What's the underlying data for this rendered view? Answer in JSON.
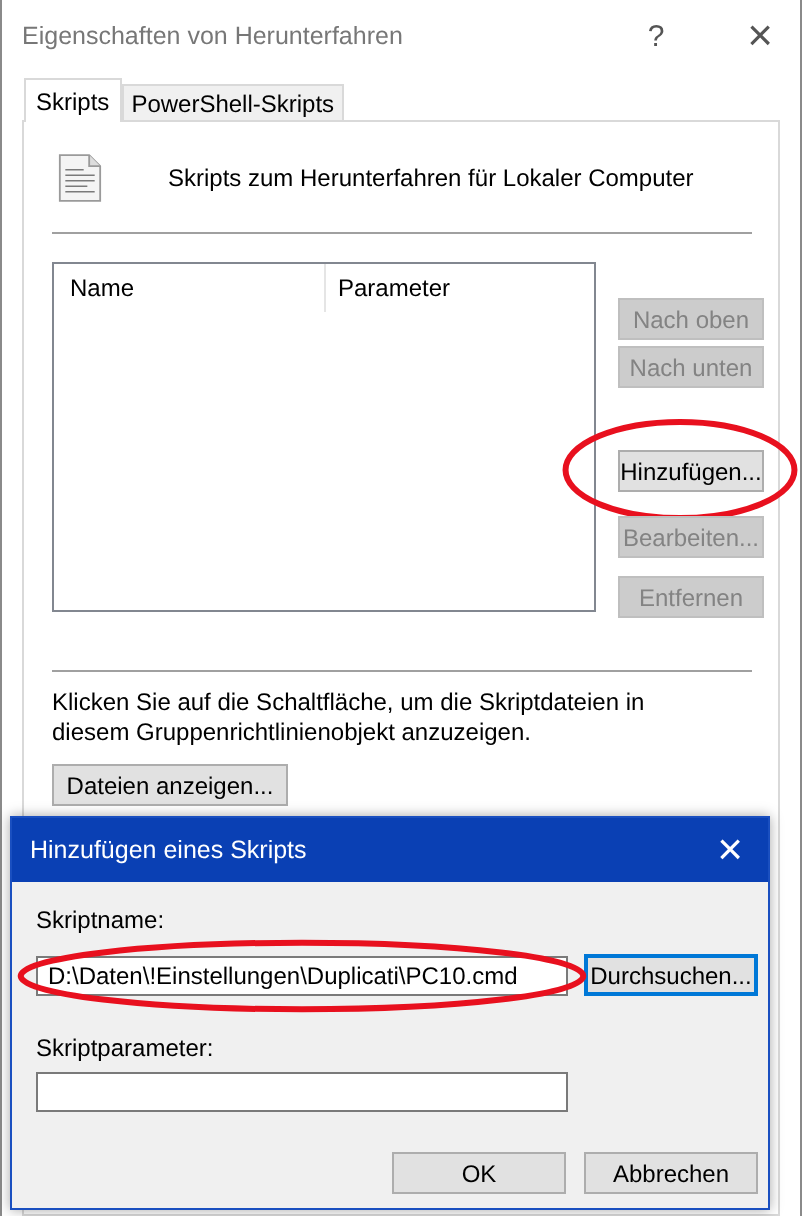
{
  "window": {
    "title": "Eigenschaften von Herunterfahren",
    "help": "?",
    "close": "×"
  },
  "tabs": [
    {
      "label": "Skripts",
      "selected": true
    },
    {
      "label": "PowerShell-Skripts",
      "selected": false
    }
  ],
  "header": "Skripts zum Herunterfahren für Lokaler Computer",
  "table": {
    "columns": [
      "Name",
      "Parameter"
    ]
  },
  "side_buttons": [
    {
      "label": "Nach oben",
      "disabled": true,
      "highlighted": false
    },
    {
      "label": "Nach unten",
      "disabled": true,
      "highlighted": false
    },
    {
      "label": "Hinzufügen...",
      "disabled": false,
      "highlighted": true
    },
    {
      "label": "Bearbeiten...",
      "disabled": true,
      "highlighted": false
    },
    {
      "label": "Entfernen",
      "disabled": true,
      "highlighted": false
    }
  ],
  "info": "Klicken Sie auf die Schaltfläche, um die Skriptdateien in diesem Gruppenrichtlinienobjekt anzuzeigen.",
  "show_files_button": "Dateien anzeigen...",
  "dialog": {
    "title": "Hinzufügen eines Skripts",
    "close": "×",
    "script_name": {
      "label": "Skriptname:",
      "value": "D:\\Daten\\!Einstellungen\\Duplicati\\PC10.cmd",
      "highlighted": true
    },
    "browse_button": {
      "label": "Durchsuchen...",
      "focused": true
    },
    "script_params": {
      "label": "Skriptparameter:"
    },
    "buttons": [
      "OK",
      "Abbrechen"
    ]
  }
}
